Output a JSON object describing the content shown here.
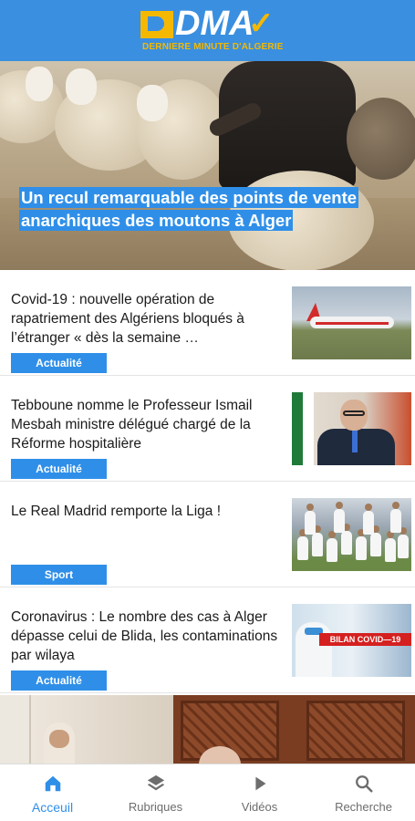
{
  "app": {
    "logo_letters": "DMA",
    "logo_tagline": "DERNIERE MINUTE D'ALGERIE",
    "brand_blue": "#3a8fe0",
    "brand_yellow": "#f5b800"
  },
  "hero": {
    "caption": "Un recul remarquable des points de vente anarchiques des moutons à Alger"
  },
  "articles": [
    {
      "title": "Covid-19 : nouvelle opération de rapatriement des Algériens bloqués à l’étranger « dès la semaine …",
      "category": "Actualité",
      "thumb_icon": "airplane-photo"
    },
    {
      "title": "Tebboune nomme le Professeur Ismail Mesbah ministre délégué chargé de la Réforme hospitalière",
      "category": "Actualité",
      "thumb_icon": "minister-photo"
    },
    {
      "title": "Le Real Madrid remporte la Liga !",
      "category": "Sport",
      "thumb_icon": "team-photo"
    },
    {
      "title": "Coronavirus : Le nombre des cas à Alger dépasse celui de Blida, les contaminations par wilaya",
      "category": "Actualité",
      "thumb_icon": "covid-photo",
      "thumb_banner": "BILAN COVID—19"
    }
  ],
  "nav": {
    "items": [
      {
        "label": "Acceuil",
        "icon": "home-icon",
        "active": true
      },
      {
        "label": "Rubriques",
        "icon": "layers-icon",
        "active": false
      },
      {
        "label": "Vidéos",
        "icon": "play-icon",
        "active": false
      },
      {
        "label": "Recherche",
        "icon": "search-icon",
        "active": false
      }
    ],
    "active_color": "#2f8fe8",
    "inactive_color": "#6d6d6d"
  }
}
